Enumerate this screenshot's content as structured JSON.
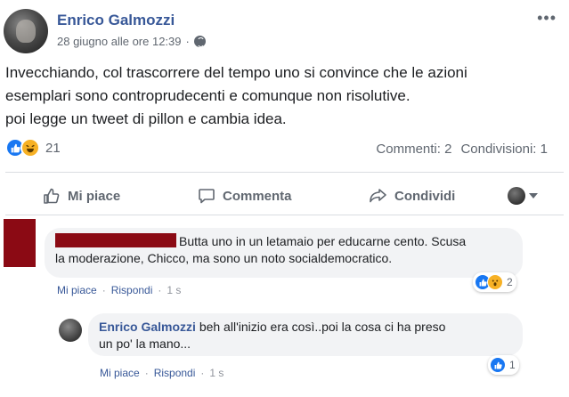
{
  "post": {
    "author": "Enrico Galmozzi",
    "date": "28 giugno alle ore 12:39",
    "separator": "·",
    "more": "•••",
    "text_lines": [
      "Invecchiando, col trascorrere del tempo uno si convince che le azioni",
      "esemplari sono controprudecenti e comunque non risolutive.",
      "poi legge un tweet di pillon e cambia idea."
    ],
    "reaction_count": "21",
    "comments": "Commenti: 2",
    "shares": "Condivisioni: 1",
    "icons": [
      "globe-icon",
      "like-reaction-icon",
      "haha-reaction-icon"
    ]
  },
  "actions": {
    "like": "Mi piace",
    "comment": "Commenta",
    "share": "Condividi"
  },
  "comments": [
    {
      "author_redacted": true,
      "text_line1": "Butta uno in un letamaio per educarne cento. Scusa",
      "text_line2": "la moderazione, Chicco, ma sono un noto socialdemocratico.",
      "like": "Mi piace",
      "reply": "Rispondi",
      "sep": "·",
      "time": "1 s",
      "reaction_count": "2"
    },
    {
      "author": "Enrico Galmozzi",
      "text_line1": "beh all'inizio era così..poi la cosa ci ha preso",
      "text_line2": "un po' la mano...",
      "like": "Mi piace",
      "reply": "Rispondi",
      "sep": "·",
      "time": "1 s",
      "reaction_count": "1"
    }
  ],
  "colors": {
    "link": "#385898",
    "like_blue": "#1877f2",
    "haha_yellow": "#f7b125",
    "redaction": "#8b0a14"
  }
}
